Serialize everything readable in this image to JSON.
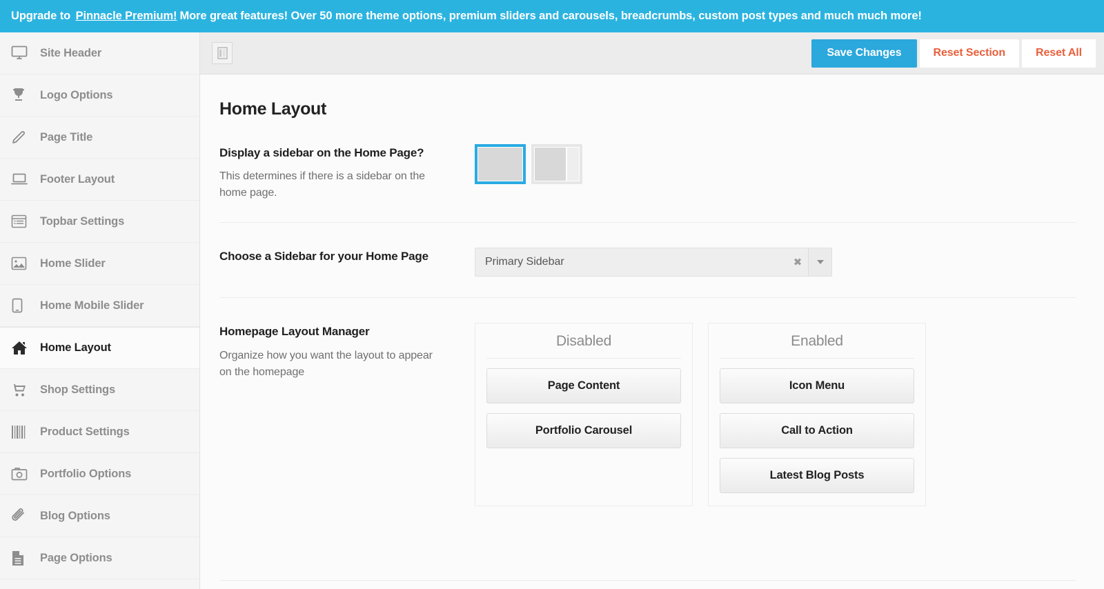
{
  "banner": {
    "lead": "Upgrade to",
    "link": "Pinnacle Premium!",
    "tail": "More great features! Over 50 more theme options, premium sliders and carousels, breadcrumbs, custom post types and much much more!",
    "background_color": "#2BB3E0"
  },
  "sidebar": {
    "items": [
      {
        "label": "Site Header",
        "icon": "monitor-icon",
        "active": false
      },
      {
        "label": "Logo Options",
        "icon": "trophy-icon",
        "active": false
      },
      {
        "label": "Page Title",
        "icon": "pencil-icon",
        "active": false
      },
      {
        "label": "Footer Layout",
        "icon": "laptop-icon",
        "active": false
      },
      {
        "label": "Topbar Settings",
        "icon": "list-panel-icon",
        "active": false
      },
      {
        "label": "Home Slider",
        "icon": "image-icon",
        "active": false
      },
      {
        "label": "Home Mobile Slider",
        "icon": "tablet-icon",
        "active": false
      },
      {
        "label": "Home Layout",
        "icon": "home-icon",
        "active": true
      },
      {
        "label": "Shop Settings",
        "icon": "cart-icon",
        "active": false
      },
      {
        "label": "Product Settings",
        "icon": "barcode-icon",
        "active": false
      },
      {
        "label": "Portfolio Options",
        "icon": "camera-icon",
        "active": false
      },
      {
        "label": "Blog Options",
        "icon": "paperclip-icon",
        "active": false
      },
      {
        "label": "Page Options",
        "icon": "document-icon",
        "active": false
      }
    ]
  },
  "toolbar": {
    "expand_icon": "expand-sidebar-icon",
    "save_label": "Save Changes",
    "reset_section_label": "Reset Section",
    "reset_all_label": "Reset All",
    "save_color": "#2BA8DC",
    "reset_color": "#E8603C"
  },
  "main": {
    "page_title": "Home Layout",
    "fields": [
      {
        "title": "Display a sidebar on the Home Page?",
        "description": "This determines if there is a sidebar on the home page.",
        "type": "image-select",
        "options": [
          {
            "name": "full-width",
            "has_sidebar": false,
            "selected": true
          },
          {
            "name": "content-with-sidebar",
            "has_sidebar": true,
            "selected": false
          }
        ],
        "selected_color": "#29ABE2"
      },
      {
        "title": "Choose a Sidebar for your Home Page",
        "description": "",
        "type": "select",
        "value": "Primary Sidebar",
        "clear_icon": "clear-x-icon",
        "caret_icon": "chevron-down-icon"
      },
      {
        "title": "Homepage Layout Manager",
        "description": "Organize how you want the layout to appear on the homepage",
        "type": "sorter",
        "panels": [
          {
            "heading": "Disabled",
            "items": [
              "Page Content",
              "Portfolio Carousel"
            ]
          },
          {
            "heading": "Enabled",
            "items": [
              "Icon Menu",
              "Call to Action",
              "Latest Blog Posts"
            ]
          }
        ]
      }
    ]
  }
}
